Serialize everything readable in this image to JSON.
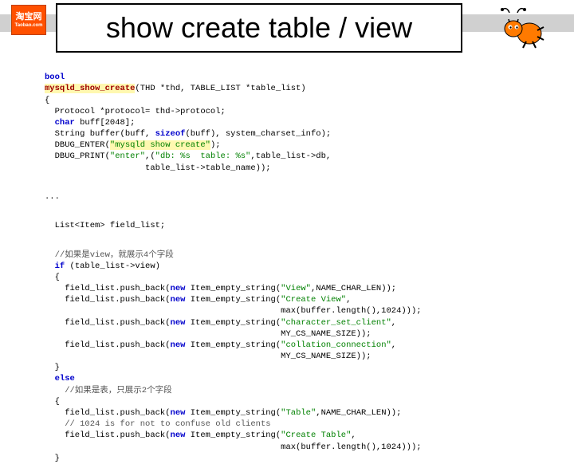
{
  "logo": {
    "cn": "淘宝网",
    "en": "Taobao.com"
  },
  "title": "show create table / view",
  "code": {
    "l01_kw": "bool",
    "l02_func": "mysqld_show_create",
    "l02_params": "(THD *thd, TABLE_LIST *table_list)",
    "l03": "{",
    "l04_a": "  Protocol *protocol= thd->protocol;",
    "l05_a": "  ",
    "l05_kw": "char",
    "l05_b": " buff[2048];",
    "l06_a": "  String buffer(buff, ",
    "l06_kw": "sizeof",
    "l06_b": "(buff), system_charset_info);",
    "l07_a": "  DBUG_ENTER(",
    "l07_str": "\"mysqld show create\"",
    "l07_b": ");",
    "l08_a": "  DBUG_PRINT(",
    "l08_str1": "\"enter\"",
    "l08_b": ",(",
    "l08_str2": "\"db: %s  table: %s\"",
    "l08_c": ",table_list->db,",
    "l09_a": "                    table_list->table_name));",
    "l10": "...",
    "l11": "  List<Item> field_list;",
    "l12_c": "  //如果是view，就展示4个字段",
    "l13_a": "  ",
    "l13_kw": "if",
    "l13_b": " (table_list->view)",
    "l14": "  {",
    "l15_a": "    field_list.push_back(",
    "l15_kw": "new",
    "l15_b": " Item_empty_string(",
    "l15_str": "\"View\"",
    "l15_c": ",NAME_CHAR_LEN));",
    "l16_a": "    field_list.push_back(",
    "l16_kw": "new",
    "l16_b": " Item_empty_string(",
    "l16_str": "\"Create View\"",
    "l16_c": ",",
    "l17_a": "                                               max(buffer.length(),1024)));",
    "l18_a": "    field_list.push_back(",
    "l18_kw": "new",
    "l18_b": " Item_empty_string(",
    "l18_str": "\"character_set_client\"",
    "l18_c": ",",
    "l19_a": "                                               MY_CS_NAME_SIZE));",
    "l20_a": "    field_list.push_back(",
    "l20_kw": "new",
    "l20_b": " Item_empty_string(",
    "l20_str": "\"collation_connection\"",
    "l20_c": ",",
    "l21_a": "                                               MY_CS_NAME_SIZE));",
    "l22": "  }",
    "l23_a": "  ",
    "l23_kw": "else",
    "l24_c": "    //如果是表，只展示2个字段",
    "l25": "  {",
    "l26_a": "    field_list.push_back(",
    "l26_kw": "new",
    "l26_b": " Item_empty_string(",
    "l26_str": "\"Table\"",
    "l26_c": ",NAME_CHAR_LEN));",
    "l27_c": "    // 1024 is for not to confuse old clients",
    "l28_a": "    field_list.push_back(",
    "l28_kw": "new",
    "l28_b": " Item_empty_string(",
    "l28_str": "\"Create Table\"",
    "l28_c": ",",
    "l29_a": "                                               max(buffer.length(),1024)));",
    "l30": "  }"
  }
}
